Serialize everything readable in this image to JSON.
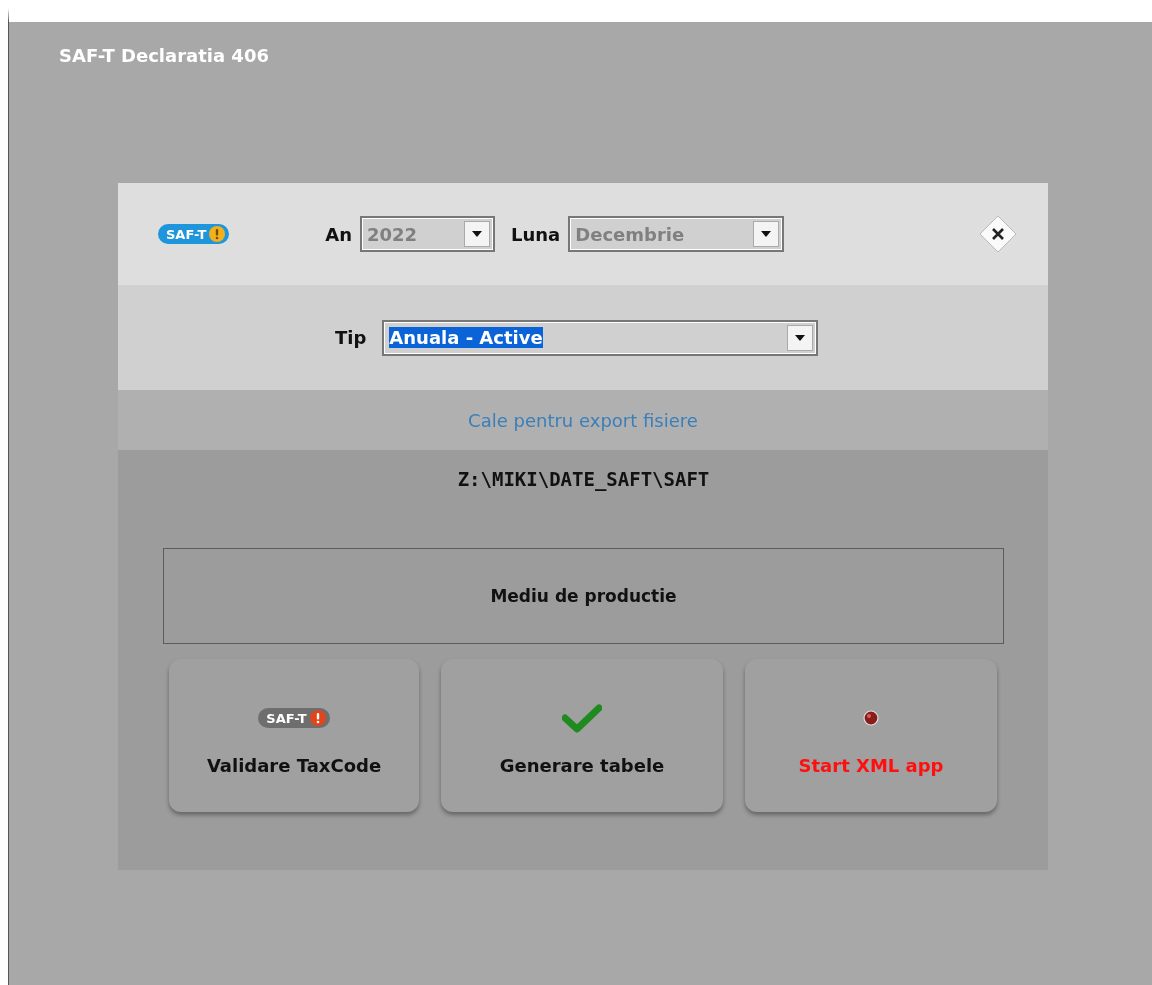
{
  "window": {
    "title": "SAF-T Declaratia 406"
  },
  "header": {
    "logo_text": "SAF-T",
    "fields": [
      {
        "label": "An",
        "value": "2022",
        "disabled": true
      },
      {
        "label": "Luna",
        "value": "Decembrie",
        "disabled": true
      }
    ]
  },
  "type_field": {
    "label": "Tip",
    "value": "Anuala - Active",
    "highlighted": true
  },
  "export": {
    "link": "Cale pentru export fisiere",
    "path": "Z:\\MIKI\\DATE_SAFT\\SAFT"
  },
  "environment": "Mediu de productie",
  "buttons": [
    {
      "kind": "logo",
      "logo_text": "SAF-T",
      "label": "Validare TaxCode",
      "warning": false
    },
    {
      "kind": "check",
      "label": "Generare tabele",
      "warning": false
    },
    {
      "kind": "led",
      "label": "Start XML app",
      "warning": true
    }
  ]
}
